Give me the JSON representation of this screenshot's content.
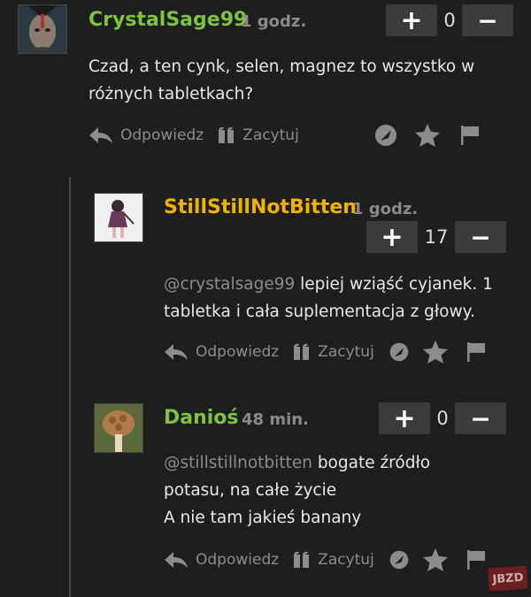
{
  "comments": [
    {
      "username": "CrystalSage99",
      "time": "1 godz.",
      "score": "0",
      "text": "Czad, a ten cynk, selen, magnez to wszystko w różnych tabletkach?",
      "text_lines": [
        "Czad, a ten cynk, selen, magnez to wszystko w",
        "różnych tabletkach?"
      ],
      "username_color": "#7ec242"
    },
    {
      "username": "StillStillNotBitten",
      "time": "1 godz.",
      "score": "17",
      "mention": "@crystalsage99",
      "text_lines": [
        "lepiej wziąść cyjanek. 1",
        "tabletka i cała suplementacja z głowy."
      ],
      "username_color": "#f0b400"
    },
    {
      "username": "Danioś",
      "time": "48 min.",
      "score": "0",
      "mention": "@stillstillnotbitten",
      "text_lines": [
        "bogate źródło",
        "potasu, na całe życie",
        "A nie tam jakieś banany"
      ],
      "username_color": "#7ec242"
    }
  ],
  "actions": {
    "reply": "Odpowiedz",
    "quote": "Zacytuj"
  },
  "vote": {
    "plus": "+",
    "minus": "−"
  },
  "watermark": "JBZD",
  "colors": {
    "background": "#1e1e1e",
    "button": "#3b3b3b",
    "muted": "#8c8c8c"
  }
}
